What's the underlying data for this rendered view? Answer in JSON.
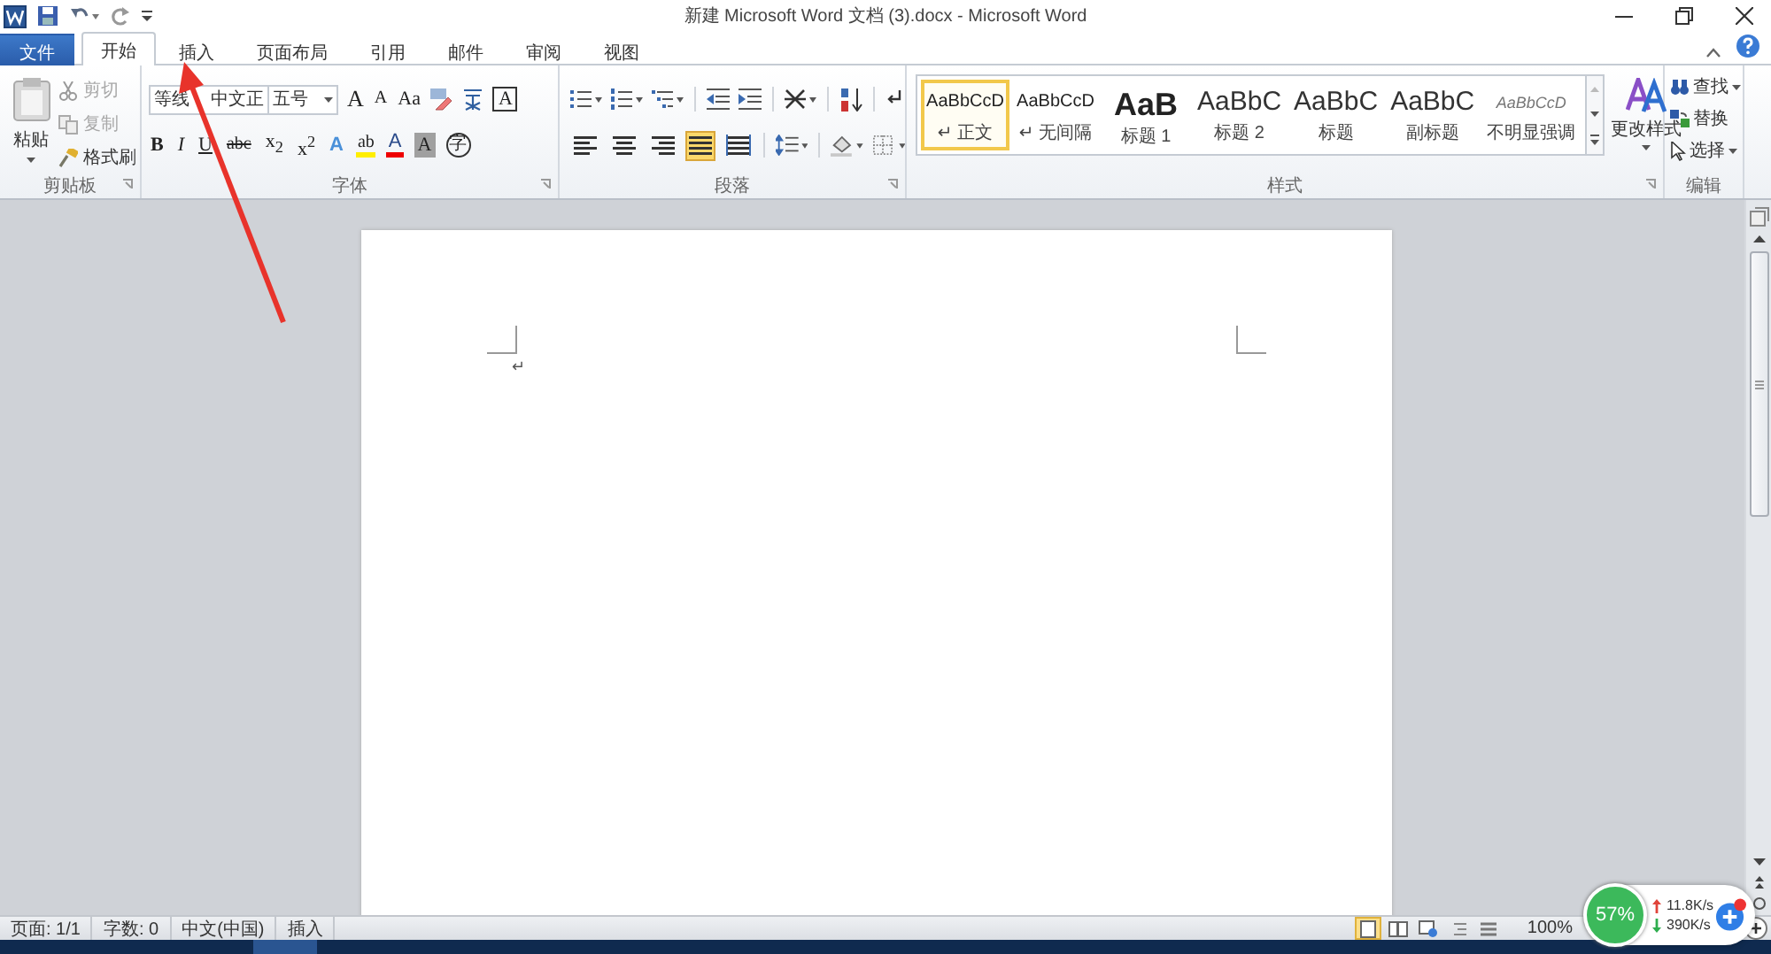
{
  "title_bar": {
    "title": "新建 Microsoft Word 文档 (3).docx - Microsoft Word"
  },
  "tabs": [
    {
      "label": "文件",
      "kind": "file",
      "selected": false
    },
    {
      "label": "开始",
      "kind": "tab",
      "selected": true
    },
    {
      "label": "插入",
      "kind": "tab",
      "selected": false
    },
    {
      "label": "页面布局",
      "kind": "tab",
      "selected": false
    },
    {
      "label": "引用",
      "kind": "tab",
      "selected": false
    },
    {
      "label": "邮件",
      "kind": "tab",
      "selected": false
    },
    {
      "label": "审阅",
      "kind": "tab",
      "selected": false
    },
    {
      "label": "视图",
      "kind": "tab",
      "selected": false
    }
  ],
  "ribbon": {
    "clipboard": {
      "label": "剪贴板",
      "paste": "粘贴",
      "items": [
        {
          "label": "剪切",
          "kind": "cut",
          "disabled": true
        },
        {
          "label": "复制",
          "kind": "copy",
          "disabled": true
        },
        {
          "label": "格式刷",
          "kind": "painter",
          "disabled": false
        }
      ]
    },
    "font": {
      "label": "字体",
      "font_name": "等线 中文正",
      "font_size": "五号",
      "row1": [
        {
          "kind": "grow",
          "label": "A"
        },
        {
          "kind": "shrink",
          "label": "A"
        },
        {
          "kind": "case",
          "label": "Aa"
        },
        {
          "kind": "clear"
        },
        {
          "kind": "phonetic"
        },
        {
          "kind": "border",
          "label": "A"
        }
      ],
      "row2": [
        {
          "kind": "bold",
          "label": "B"
        },
        {
          "kind": "italic",
          "label": "I"
        },
        {
          "kind": "underline",
          "label": "U"
        },
        {
          "kind": "strike",
          "label": "abc"
        },
        {
          "kind": "sub",
          "label": "x$_{2}$"
        },
        {
          "kind": "sup",
          "label": "x$^{2}$"
        },
        {
          "kind": "effects",
          "label": "A"
        },
        {
          "kind": "highlight",
          "label": "ab"
        },
        {
          "kind": "color",
          "label": "A"
        },
        {
          "kind": "shade",
          "label": "A"
        },
        {
          "kind": "enclose",
          "label": "字"
        }
      ]
    },
    "paragraph": {
      "label": "段落",
      "alignments": [
        {
          "kind": "left",
          "selected": false
        },
        {
          "kind": "center",
          "selected": false
        },
        {
          "kind": "right",
          "selected": false
        },
        {
          "kind": "justify",
          "selected": true
        },
        {
          "kind": "distributed",
          "selected": false
        }
      ]
    },
    "styles": {
      "label": "样式",
      "items": [
        {
          "preview": "AaBbCcD",
          "label": "↵ 正文",
          "kind": "normal",
          "selected": true
        },
        {
          "preview": "AaBbCcD",
          "label": "↵ 无间隔",
          "kind": "normal",
          "selected": false
        },
        {
          "preview": "AaB",
          "label": "标题 1",
          "kind": "heading1",
          "selected": false
        },
        {
          "preview": "AaBbC",
          "label": "标题 2",
          "kind": "heading",
          "selected": false
        },
        {
          "preview": "AaBbC",
          "label": "标题",
          "kind": "heading",
          "selected": false
        },
        {
          "preview": "AaBbC",
          "label": "副标题",
          "kind": "heading",
          "selected": false
        },
        {
          "preview": "AaBbCcD",
          "label": "不明显强调",
          "kind": "subtle",
          "selected": false
        }
      ],
      "change_styles": "更改样式"
    },
    "editing": {
      "label": "编辑",
      "items": [
        {
          "label": "查找",
          "kind": "find",
          "dropdown": true
        },
        {
          "label": "替换",
          "kind": "replace",
          "dropdown": false
        },
        {
          "label": "选择",
          "kind": "select",
          "dropdown": true
        }
      ]
    }
  },
  "document": {
    "paragraph_mark": "↵"
  },
  "status_bar": {
    "items": [
      "页面: 1/1",
      "字数: 0",
      "中文(中国)",
      "插入"
    ],
    "views": [
      {
        "kind": "print",
        "selected": true
      },
      {
        "kind": "reading",
        "selected": false
      },
      {
        "kind": "web",
        "selected": false
      },
      {
        "kind": "outline",
        "selected": false
      },
      {
        "kind": "draft",
        "selected": false
      }
    ],
    "zoom": "100%"
  },
  "speed_widget": {
    "percent": "57%",
    "upload": "11.8K/s",
    "download": "390K/s"
  }
}
